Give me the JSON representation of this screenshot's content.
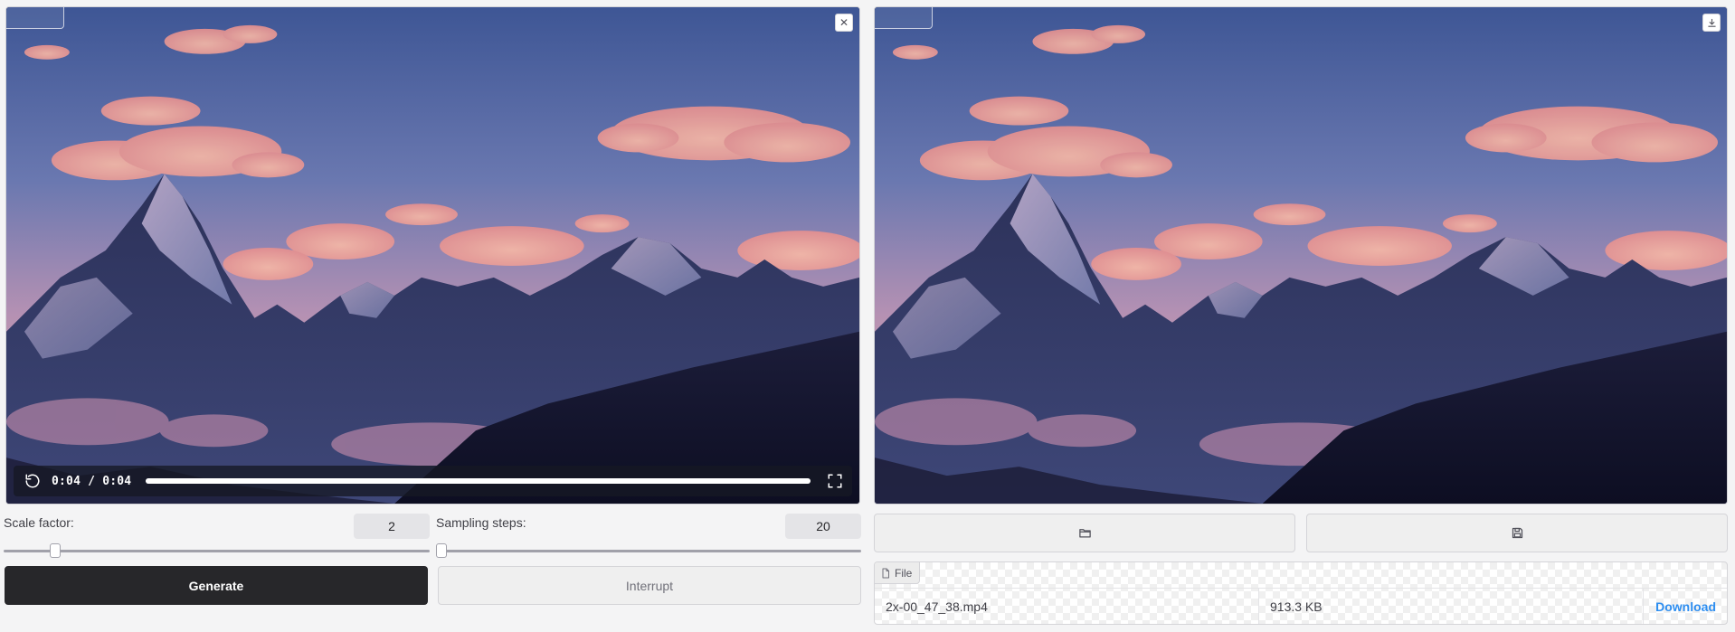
{
  "input_video": {
    "current_time": "0:04",
    "separator": "/",
    "duration": "0:04",
    "progress_fraction": 1.0
  },
  "controls": {
    "scale_factor": {
      "label": "Scale factor:",
      "value": "2",
      "fraction": 0.12
    },
    "sampling_steps": {
      "label": "Sampling steps:",
      "value": "20",
      "fraction": 0.0
    }
  },
  "buttons": {
    "generate": "Generate",
    "interrupt": "Interrupt"
  },
  "output_file": {
    "tag_label": "File",
    "name": "2x-00_47_38.mp4",
    "size": "913.3 KB",
    "download_label": "Download"
  },
  "icons": {
    "close": "close-icon",
    "download": "download-icon",
    "replay": "replay-icon",
    "fullscreen": "fullscreen-icon",
    "folder": "folder-icon",
    "save": "save-icon",
    "file": "file-icon"
  },
  "colors": {
    "primary_button": "#27272a",
    "link": "#2e8ef0"
  }
}
